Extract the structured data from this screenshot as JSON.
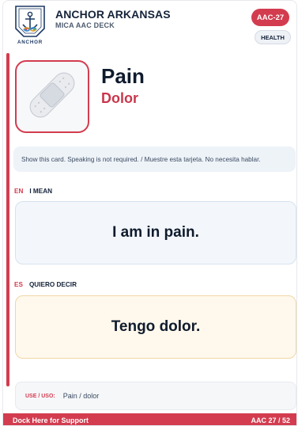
{
  "header": {
    "org_name": "ANCHOR ARKANSAS",
    "deck_name": "MICA AAC DECK",
    "logo_text": "ANCHOR",
    "code": "AAC-27",
    "category": "HEALTH"
  },
  "card": {
    "image_icon": "bandage-icon",
    "word_en": "Pain",
    "word_es": "Dolor",
    "instruction": "Show this card. Speaking is not required. / Muestre esta tarjeta. No necesita hablar."
  },
  "english": {
    "lang_code": "EN",
    "label": "I MEAN",
    "phrase": "I am in pain."
  },
  "spanish": {
    "lang_code": "ES",
    "label": "QUIERO DECIR",
    "phrase": "Tengo dolor."
  },
  "usage": {
    "label": "USE / USO:",
    "text": "Pain / dolor"
  },
  "footer": {
    "left": "Dock Here for Support",
    "right": "AAC 27 / 52"
  },
  "colors": {
    "accent": "#d33c4f",
    "navy": "#15233a",
    "english_bg": "#f3f7fb",
    "spanish_bg": "#fff8ec"
  }
}
